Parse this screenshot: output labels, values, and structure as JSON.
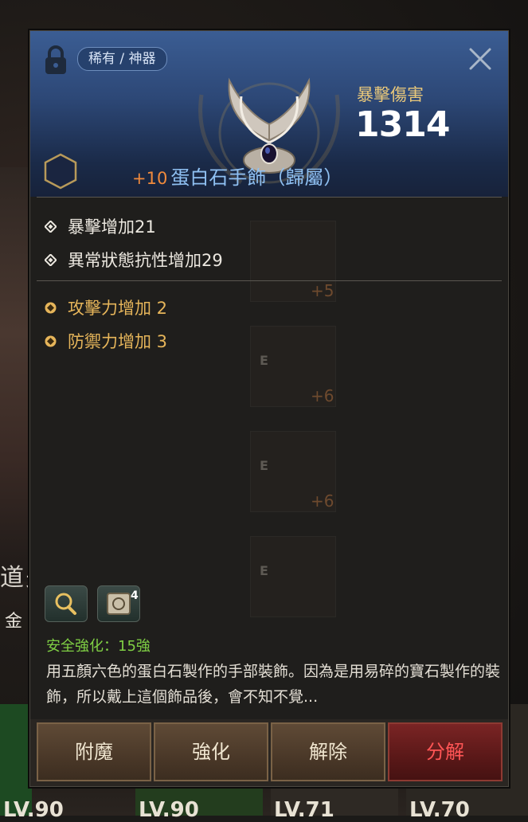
{
  "background": {
    "character_name": "道夫耶加喏",
    "character_subname": "金 後",
    "lv_labels": [
      "LV.90",
      "LV.90",
      "LV.71",
      "LV.70"
    ]
  },
  "item": {
    "rarity_tag": "稀有 / 神器",
    "stat_label": "暴擊傷害",
    "stat_value": "1314",
    "enhance_level": "+10",
    "name": "蛋白石手飾（歸屬）",
    "base_attributes": [
      "暴擊增加21",
      "異常狀態抗性增加29"
    ],
    "bonus_attributes": [
      "攻擊力增加 2",
      "防禦力增加 3"
    ],
    "safe_enhance": "安全強化：15強",
    "description": "用五顏六色的蛋白石製作的手部裝飾。因為是用易碎的寶石製作的裝飾，所以戴上這個飾品後，會不知不覺...",
    "book_count": "4"
  },
  "ghost_slots": [
    "+5",
    "+6",
    "+6"
  ],
  "actions": {
    "enchant": "附魔",
    "enhance": "強化",
    "release": "解除",
    "disassemble": "分解"
  },
  "colors": {
    "header_blue": "#2d4877",
    "gold": "#e6b55a",
    "name_blue": "#8fc0f2",
    "enhance_orange": "#f08a3c",
    "safe_green": "#7fcf44",
    "disassemble_red": "#ff5555"
  },
  "icons": [
    "lock-icon",
    "close-icon",
    "wreath-icon",
    "hexagon-icon",
    "diamond-icon",
    "magnify-icon",
    "book-icon"
  ]
}
